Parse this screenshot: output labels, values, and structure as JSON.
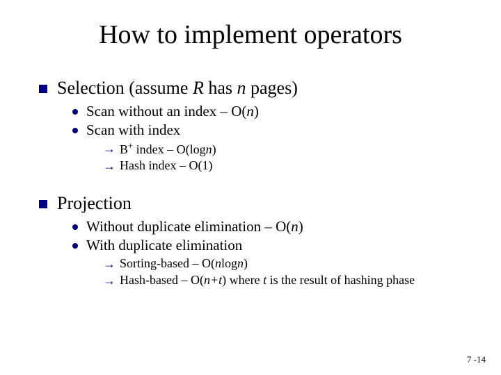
{
  "title": "How to implement operators",
  "sections": [
    {
      "heading_pre": "Selection (assume ",
      "heading_it1": "R",
      "heading_mid": " has ",
      "heading_it2": "n",
      "heading_post": " pages)",
      "items": [
        {
          "text_pre": "Scan without an index – O(",
          "text_it": "n",
          "text_post": ")",
          "subs": []
        },
        {
          "text_pre": "Scan with index",
          "text_it": "",
          "text_post": "",
          "subs": [
            {
              "pre": "B",
              "sup": "+",
              "mid": " index – O(log",
              "it": "n",
              "post": ")"
            },
            {
              "pre": "Hash index – O(1)",
              "sup": "",
              "mid": "",
              "it": "",
              "post": ""
            }
          ]
        }
      ]
    },
    {
      "heading_pre": "Projection",
      "heading_it1": "",
      "heading_mid": "",
      "heading_it2": "",
      "heading_post": "",
      "items": [
        {
          "text_pre": "Without duplicate elimination – O(",
          "text_it": "n",
          "text_post": ")",
          "subs": []
        },
        {
          "text_pre": "With duplicate elimination",
          "text_it": "",
          "text_post": "",
          "subs": [
            {
              "pre": "Sorting-based – O(",
              "sup": "",
              "mid": "",
              "it": "n",
              "post": "log",
              "it2": "n",
              "post2": ")"
            },
            {
              "pre": "Hash-based – O(",
              "sup": "",
              "mid": "",
              "it": "n+t",
              "post": ") where ",
              "it2": "t",
              "post2": " is the result of hashing phase"
            }
          ]
        }
      ]
    }
  ],
  "pagenum": "7 -14"
}
